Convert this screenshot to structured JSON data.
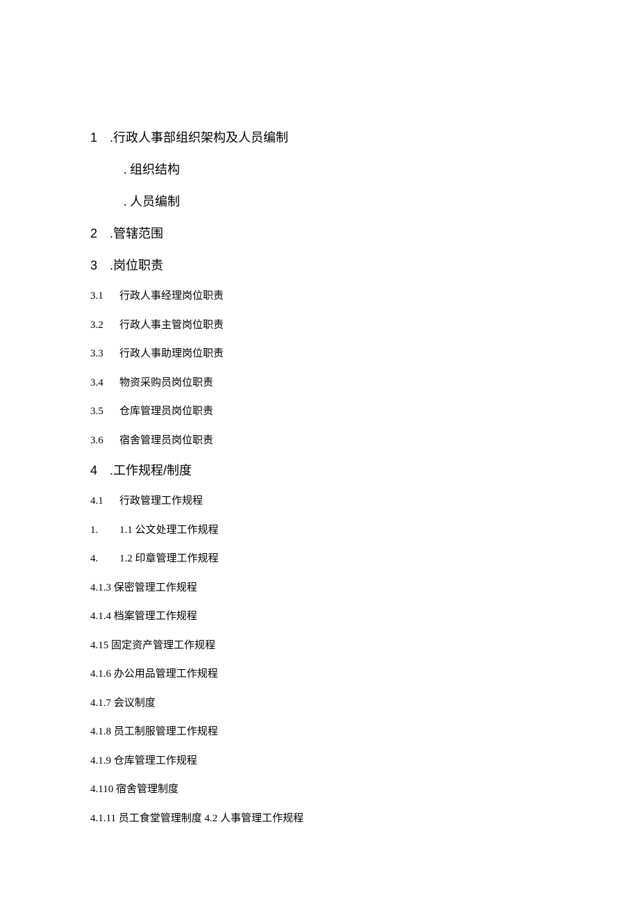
{
  "toc": [
    {
      "type": "l1",
      "num": "1",
      "title": ".行政人事部组织架构及人员编制"
    },
    {
      "type": "l1sub",
      "title": ". 组织结构"
    },
    {
      "type": "l1sub",
      "title": ". 人员编制"
    },
    {
      "type": "l1",
      "num": "2",
      "title": ".管辖范围"
    },
    {
      "type": "l1",
      "num": "3",
      "title": ".岗位职责"
    },
    {
      "type": "split",
      "num": "3.1",
      "title": "行政人事经理岗位职责"
    },
    {
      "type": "split",
      "num": "3.2",
      "title": "行政人事主管岗位职责"
    },
    {
      "type": "split",
      "num": "3.3",
      "title": "行政人事助理岗位职责"
    },
    {
      "type": "split",
      "num": "3.4",
      "title": "物资采购员岗位职责"
    },
    {
      "type": "split",
      "num": "3.5",
      "title": "仓库管理员岗位职责"
    },
    {
      "type": "split",
      "num": "3.6",
      "title": "宿舍管理员岗位职责"
    },
    {
      "type": "l1",
      "num": "4",
      "title": ".工作规程/制度"
    },
    {
      "type": "split",
      "num": "4.1",
      "title": "行政管理工作规程"
    },
    {
      "type": "split",
      "num": "1.",
      "title": "1.1 公文处理工作规程"
    },
    {
      "type": "split",
      "num": "4.",
      "title": "1.2 印章管理工作规程"
    },
    {
      "type": "plain",
      "title": "4.1.3 保密管理工作规程"
    },
    {
      "type": "plain",
      "title": "4.1.4 档案管理工作规程"
    },
    {
      "type": "plain",
      "title": "4.15 固定资产管理工作规程"
    },
    {
      "type": "plain",
      "title": "4.1.6 办公用品管理工作规程"
    },
    {
      "type": "plain",
      "title": "4.1.7 会议制度"
    },
    {
      "type": "plain",
      "title": "4.1.8 员工制服管理工作规程"
    },
    {
      "type": "plain",
      "title": "4.1.9 仓库管理工作规程"
    },
    {
      "type": "plain",
      "title": "4.110 宿舍管理制度"
    },
    {
      "type": "plain",
      "title": "4.1.11 员工食堂管理制度 4.2 人事管理工作规程"
    }
  ]
}
